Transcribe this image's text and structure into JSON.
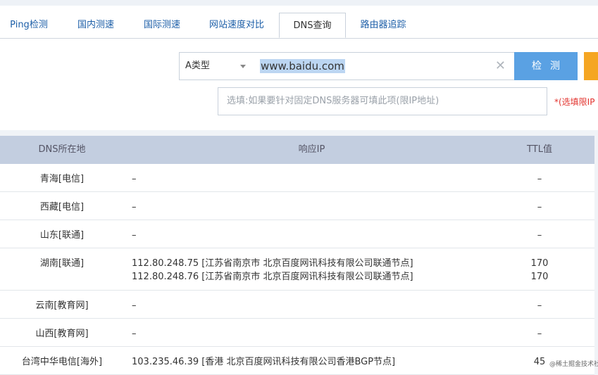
{
  "tabs": [
    {
      "label": "Ping检测"
    },
    {
      "label": "国内测速"
    },
    {
      "label": "国际测速"
    },
    {
      "label": "网站速度对比"
    },
    {
      "label": "DNS查询"
    },
    {
      "label": "路由器追踪"
    }
  ],
  "form": {
    "record_type": "A类型",
    "domain_value": "www.baidu.com",
    "check_button": "检测",
    "dns_placeholder": "选填:如果要针对固定DNS服务器可填此项(限IP地址)",
    "hint": "*(选填限IP"
  },
  "table": {
    "headers": {
      "location": "DNS所在地",
      "ip": "响应IP",
      "ttl": "TTL值"
    },
    "rows": [
      {
        "location": "青海[电信]",
        "ips": [
          "–"
        ],
        "ttls": [
          "–"
        ]
      },
      {
        "location": "西藏[电信]",
        "ips": [
          "–"
        ],
        "ttls": [
          "–"
        ]
      },
      {
        "location": "山东[联通]",
        "ips": [
          "–"
        ],
        "ttls": [
          "–"
        ]
      },
      {
        "location": "湖南[联通]",
        "ips": [
          "112.80.248.75 [江苏省南京市 北京百度网讯科技有限公司联通节点]",
          "112.80.248.76 [江苏省南京市 北京百度网讯科技有限公司联通节点]"
        ],
        "ttls": [
          "170",
          "170"
        ]
      },
      {
        "location": "云南[教育网]",
        "ips": [
          "–"
        ],
        "ttls": [
          "–"
        ]
      },
      {
        "location": "山西[教育网]",
        "ips": [
          "–"
        ],
        "ttls": [
          "–"
        ]
      },
      {
        "location": "台湾中华电信[海外]",
        "ips": [
          "103.235.46.39 [香港 北京百度网讯科技有限公司香港BGP节点]"
        ],
        "ttls": [
          "45"
        ]
      }
    ]
  },
  "watermark": "@稀土掘金技术社区"
}
